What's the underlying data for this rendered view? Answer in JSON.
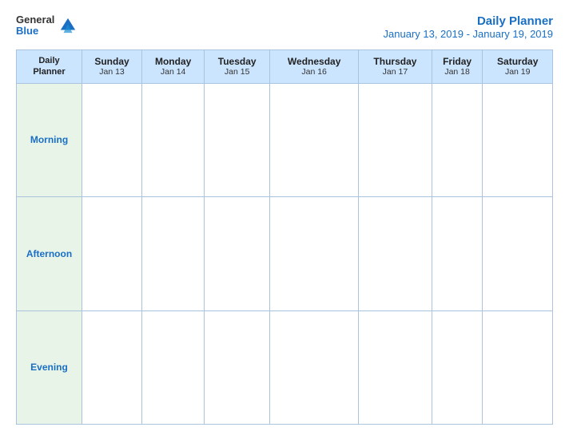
{
  "header": {
    "logo_general": "General",
    "logo_blue": "Blue",
    "title": "Daily Planner",
    "subtitle": "January 13, 2019 - January 19, 2019"
  },
  "table": {
    "header_label": "Daily\nPlanner",
    "days": [
      {
        "name": "Sunday",
        "date": "Jan 13"
      },
      {
        "name": "Monday",
        "date": "Jan 14"
      },
      {
        "name": "Tuesday",
        "date": "Jan 15"
      },
      {
        "name": "Wednesday",
        "date": "Jan 16"
      },
      {
        "name": "Thursday",
        "date": "Jan 17"
      },
      {
        "name": "Friday",
        "date": "Jan 18"
      },
      {
        "name": "Saturday",
        "date": "Jan 19"
      }
    ],
    "rows": [
      {
        "label": "Morning"
      },
      {
        "label": "Afternoon"
      },
      {
        "label": "Evening"
      }
    ]
  }
}
